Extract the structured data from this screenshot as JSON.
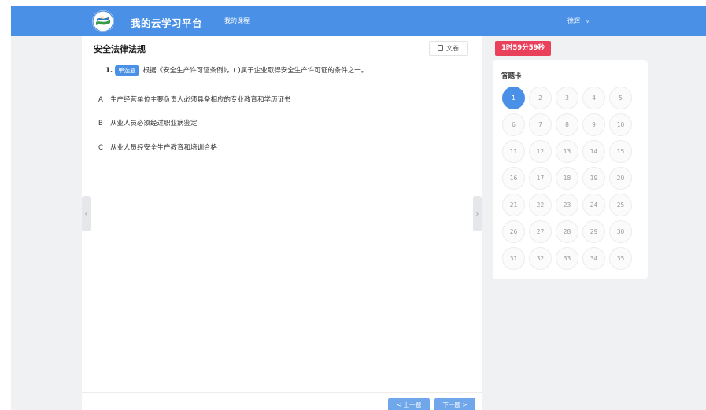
{
  "header": {
    "brand": "我的云学习平台",
    "nav_courses": "我的课程",
    "user_name": "徐辉",
    "logo_icon": "logo-emblem-icon",
    "user_chevron_icon": "chevron-down-icon",
    "bar_color": "#4a90e6"
  },
  "exam": {
    "section_title": "安全法律法规",
    "draft_button": "文卷",
    "question_number": "1.",
    "question_type": "单选题",
    "question_text": "根据《安全生产许可证条例》，( )属于企业取得安全生产许可证的条件之一。",
    "options": [
      {
        "letter": "A",
        "text": "生产经营单位主要负责人必须具备相应的专业教育和学历证书"
      },
      {
        "letter": "B",
        "text": "从业人员必须经过职业病鉴定"
      },
      {
        "letter": "C",
        "text": "从业人员经安全生产教育和培训合格"
      }
    ],
    "prev_button": "< 上一题",
    "next_button": "下一题 >"
  },
  "timer": {
    "text": "1时59分59秒",
    "color": "#e9405c"
  },
  "answer_card": {
    "title": "答题卡",
    "current": 1,
    "numbers": [
      "1",
      "2",
      "3",
      "4",
      "5",
      "6",
      "7",
      "8",
      "9",
      "10",
      "11",
      "12",
      "13",
      "14",
      "15",
      "16",
      "17",
      "18",
      "19",
      "20",
      "21",
      "22",
      "23",
      "24",
      "25",
      "26",
      "27",
      "28",
      "29",
      "30",
      "31",
      "32",
      "33",
      "34",
      "35"
    ]
  },
  "side_arrows": {
    "left": "‹",
    "right": "›"
  }
}
